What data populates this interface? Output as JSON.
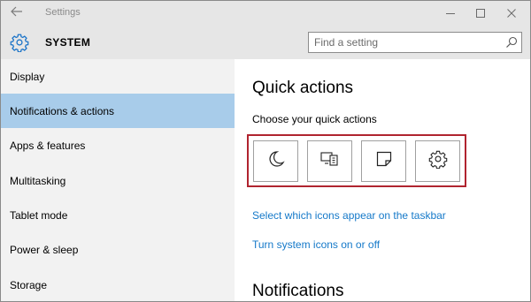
{
  "window": {
    "title": "Settings"
  },
  "header": {
    "section_title": "SYSTEM",
    "search_placeholder": "Find a setting"
  },
  "sidebar": {
    "items": [
      {
        "label": "Display",
        "active": false
      },
      {
        "label": "Notifications & actions",
        "active": true
      },
      {
        "label": "Apps & features",
        "active": false
      },
      {
        "label": "Multitasking",
        "active": false
      },
      {
        "label": "Tablet mode",
        "active": false
      },
      {
        "label": "Power & sleep",
        "active": false
      },
      {
        "label": "Storage",
        "active": false
      }
    ]
  },
  "main": {
    "heading": "Quick actions",
    "subheading": "Choose your quick actions",
    "quick_actions": [
      {
        "icon": "moon-icon"
      },
      {
        "icon": "project-display-icon"
      },
      {
        "icon": "note-icon"
      },
      {
        "icon": "settings-gear-icon"
      }
    ],
    "link_taskbar_icons": "Select which icons appear on the taskbar",
    "link_system_icons": "Turn system icons on or off",
    "notifications_heading": "Notifications"
  },
  "colors": {
    "accent_link": "#1579c9",
    "selection": "#a8ccea",
    "highlight_border": "#b0242f"
  }
}
